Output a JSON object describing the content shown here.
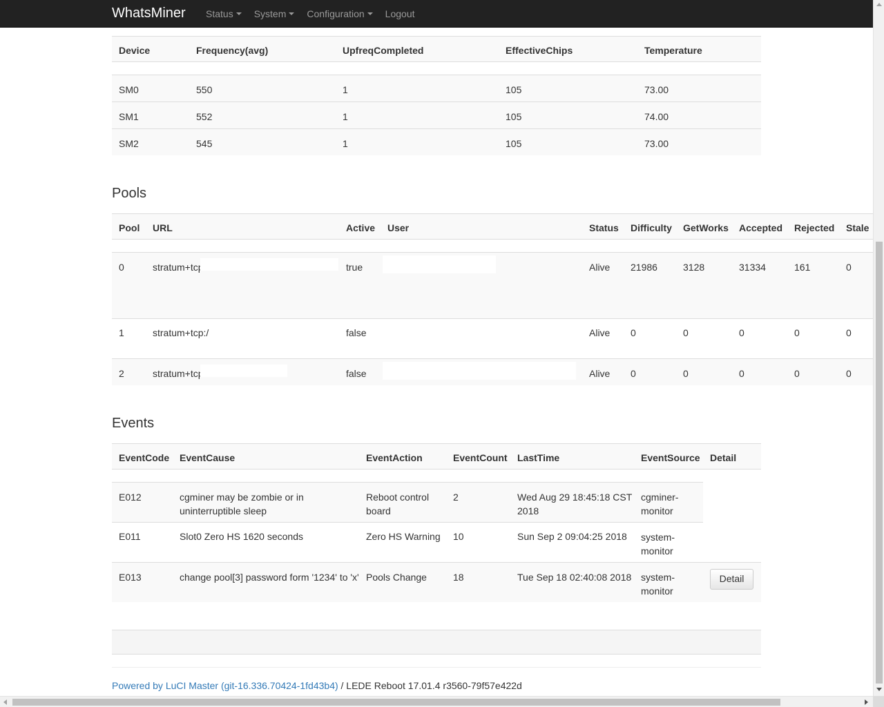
{
  "nav": {
    "brand": "WhatsMiner",
    "items": [
      "Status",
      "System",
      "Configuration",
      "Logout"
    ]
  },
  "devices": {
    "headers": [
      "Device",
      "Frequency(avg)",
      "UpfreqCompleted",
      "EffectiveChips",
      "Temperature"
    ],
    "rows": [
      [
        "SM0",
        "550",
        "1",
        "105",
        "73.00"
      ],
      [
        "SM1",
        "552",
        "1",
        "105",
        "74.00"
      ],
      [
        "SM2",
        "545",
        "1",
        "105",
        "73.00"
      ]
    ]
  },
  "pools": {
    "title": "Pools",
    "headers": [
      "Pool",
      "URL",
      "Active",
      "User",
      "Status",
      "Difficulty",
      "GetWorks",
      "Accepted",
      "Rejected",
      "Stale"
    ],
    "rows": [
      [
        "0",
        "stratum+tcp://",
        "true",
        "",
        "Alive",
        "21986",
        "3128",
        "31334",
        "161",
        "0"
      ],
      [
        "1",
        "stratum+tcp:/",
        "false",
        "",
        "Alive",
        "0",
        "0",
        "0",
        "0",
        "0"
      ],
      [
        "2",
        "stratum+tcp://",
        "false",
        "",
        "Alive",
        "0",
        "0",
        "0",
        "0",
        "0"
      ]
    ]
  },
  "events": {
    "title": "Events",
    "headers": [
      "EventCode",
      "EventCause",
      "EventAction",
      "EventCount",
      "LastTime",
      "EventSource",
      "Detail"
    ],
    "rows": [
      [
        "E012",
        "cgminer may be zombie or in uninterruptible sleep",
        "Reboot control board",
        "2",
        "Wed Aug 29 18:45:18 CST 2018",
        "cgminer-monitor"
      ],
      [
        "E011",
        "Slot0 Zero HS 1620 seconds",
        "Zero HS Warning",
        "10",
        "Sun Sep 2 09:04:25 2018",
        "system-monitor"
      ],
      [
        "E013",
        "change pool[3] password form '1234' to 'x'",
        "Pools Change",
        "18",
        "Tue Sep 18 02:40:08 2018",
        "system-monitor"
      ]
    ],
    "detail_button": "Detail"
  },
  "footer": {
    "link": "Powered by LuCI Master (git-16.336.70424-1fd43b4)",
    "rest": " / LEDE Reboot 17.01.4 r3560-79f57e422d"
  }
}
